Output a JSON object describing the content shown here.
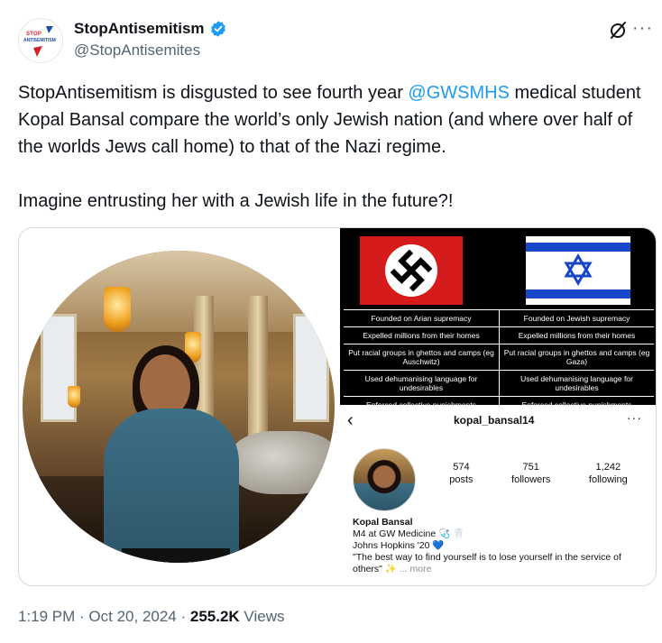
{
  "author": {
    "display_name": "StopAntisemitism",
    "handle": "@StopAntisemites",
    "avatar_line1": "STOP",
    "avatar_line2": "ANTISEMITISM"
  },
  "tweet": {
    "p1_before": "StopAntisemitism is disgusted to see fourth year ",
    "mention": "@GWSMHS",
    "p1_after": " medical student Kopal Bansal compare the world’s only Jewish nation (and where over half of the worlds Jews call home) to that of the Nazi regime.",
    "p2": "Imagine entrusting her with a Jewish life in the future?!"
  },
  "comparison": {
    "rows": [
      [
        "Founded on Arian supremacy",
        "Founded on Jewish supremacy"
      ],
      [
        "Expelled millions from their homes",
        "Expelled millions from their homes"
      ],
      [
        "Put racial groups in ghettos and camps (eg Auschwitz)",
        "Put racial groups in ghettos and camps (eg Gaza)"
      ],
      [
        "Used dehumanising language for undesirables",
        "Used dehumanising language for undesirables"
      ],
      [
        "Enforced collective punishments",
        "Enforced collective punishments"
      ]
    ]
  },
  "instagram": {
    "username": "kopal_bansal14",
    "stats": [
      {
        "value": "574",
        "label": "posts"
      },
      {
        "value": "751",
        "label": "followers"
      },
      {
        "value": "1,242",
        "label": "following"
      }
    ],
    "bio_name": "Kopal Bansal",
    "bio_line1": "M4 at GW Medicine 🩺 🦷",
    "bio_line2": "Johns Hopkins '20 ",
    "bio_heart": "💙",
    "bio_quote": "\"The best way to find yourself is to lose yourself in the service of others\" ✨",
    "bio_more": "... more"
  },
  "meta": {
    "time_date": "1:19 PM · Oct 20, 2024 · ",
    "views_count": "255.2K",
    "views_label": " Views"
  },
  "icons": {
    "verified": "verified-badge-icon",
    "grok": "grok-icon",
    "more": "more-options-icon"
  },
  "colors": {
    "accent": "#1d9bf0",
    "text": "#0f1419",
    "muted": "#536471"
  }
}
